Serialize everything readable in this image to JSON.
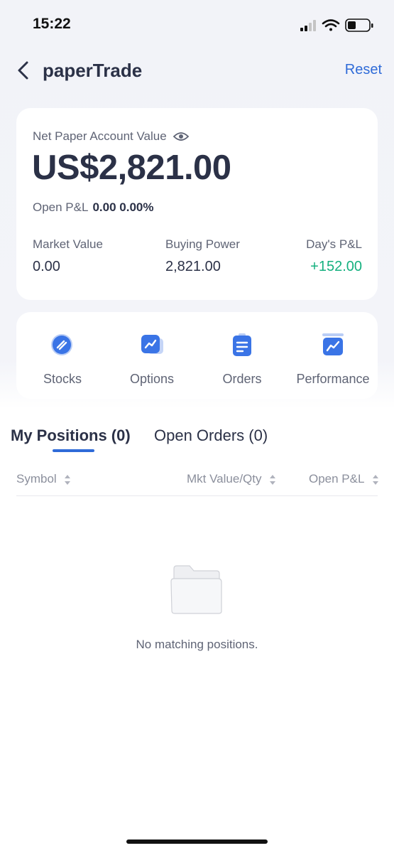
{
  "status_bar": {
    "time": "15:22"
  },
  "nav": {
    "title": "paperTrade",
    "reset_label": "Reset"
  },
  "account": {
    "label": "Net Paper Account Value",
    "value": "US$2,821.00",
    "open_pl_label": "Open P&L",
    "open_pl_value": "0.00 0.00%",
    "stats": [
      {
        "label": "Market Value",
        "value": "0.00"
      },
      {
        "label": "Buying Power",
        "value": "2,821.00"
      },
      {
        "label": "Day's P&L",
        "value": "+152.00"
      }
    ]
  },
  "actions": [
    {
      "label": "Stocks",
      "icon": "stocks-icon"
    },
    {
      "label": "Options",
      "icon": "options-icon"
    },
    {
      "label": "Orders",
      "icon": "orders-icon"
    },
    {
      "label": "Performance",
      "icon": "performance-icon"
    }
  ],
  "tabs": [
    {
      "label": "My Positions (0)",
      "active": true
    },
    {
      "label": "Open Orders (0)",
      "active": false
    }
  ],
  "table": {
    "columns": [
      "Symbol",
      "Mkt Value/Qty",
      "Open P&L"
    ]
  },
  "empty_state": {
    "text": "No matching positions.",
    "icon": "empty-folder-icon"
  },
  "colors": {
    "accent": "#2f6bd8",
    "positive": "#15b07f",
    "text": "#2b3147"
  }
}
